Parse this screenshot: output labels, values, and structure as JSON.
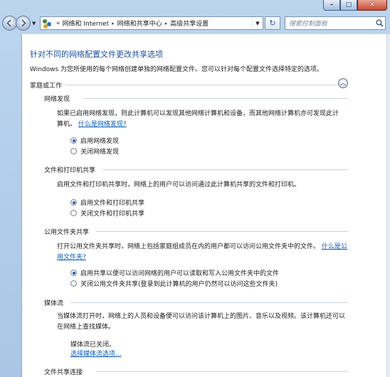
{
  "window": {
    "caption": {
      "minimize": "–",
      "maximize": "□",
      "close": "✕"
    }
  },
  "nav": {
    "back_icon": "back-arrow-icon",
    "forward_icon": "forward-arrow-icon",
    "address_prefix": "«",
    "breadcrumbs": [
      "网络和 Internet",
      "网络和共享中心",
      "高级共享设置"
    ],
    "refresh_glyph": "↻",
    "search_placeholder": "搜索控制面板"
  },
  "page": {
    "title": "针对不同的网络配置文件更改共享选项",
    "subtitle": "Windows 为您所使用的每个网络创建单独的网络配置文件。您可以针对每个配置文件选择特定的选项。",
    "profile_label": "家庭或工作",
    "collapse_glyph": "︿"
  },
  "groups": {
    "discovery": {
      "title": "网络发现",
      "desc": "如果已启用网络发现，则此计算机可以发现其他网络计算机和设备，而其他网络计算机亦可发现此计算机。",
      "link": "什么是网络发现?",
      "options": [
        {
          "label": "启用网络发现",
          "selected": true
        },
        {
          "label": "关闭网络发现",
          "selected": false
        }
      ]
    },
    "file_print": {
      "title": "文件和打印机共享",
      "desc": "启用文件和打印机共享时，网络上的用户可以访问通过此计算机共享的文件和打印机。",
      "options": [
        {
          "label": "启用文件和打印机共享",
          "selected": true
        },
        {
          "label": "关闭文件和打印机共享",
          "selected": false
        }
      ]
    },
    "public_folder": {
      "title": "公用文件夹共享",
      "desc": "打开公用文件夹共享时，网络上包括家庭组成员在内的用户都可以访问公用文件夹中的文件。",
      "link": "什么是公用文件夹?",
      "options": [
        {
          "label": "启用共享以便可以访问网络的用户可以读取和写入公用文件夹中的文件",
          "selected": true
        },
        {
          "label": "关闭公用文件夹共享(登录到此计算机的用户仍然可以访问这些文件夹)",
          "selected": false
        }
      ]
    },
    "media": {
      "title": "媒体流",
      "desc": "当媒体流打开时，网络上的人员和设备便可以访问该计算机上的图片、音乐以及视频。该计算机还可以在网络上查找媒体。",
      "status": "媒体流已关闭。",
      "link": "选择媒体流选项..."
    },
    "file_sharing": {
      "title": "文件共享连接"
    }
  }
}
